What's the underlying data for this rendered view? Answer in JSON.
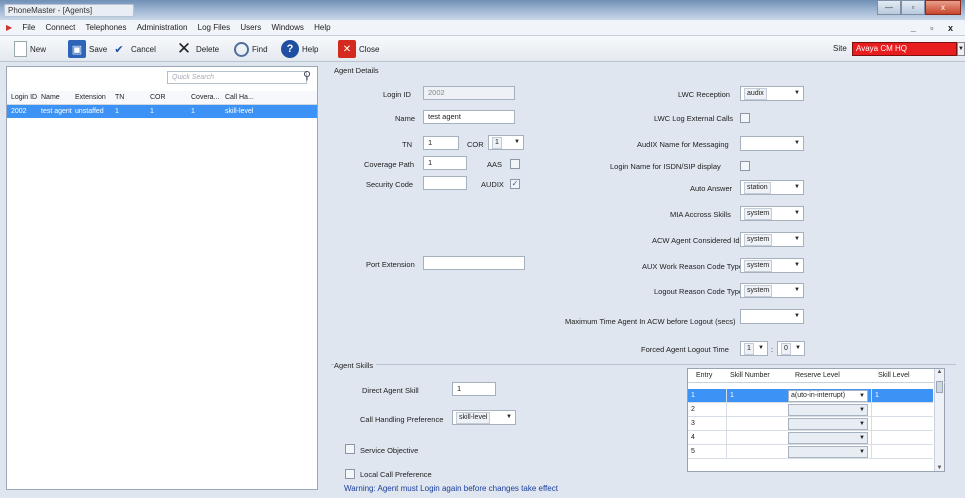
{
  "window": {
    "title": "PhoneMaster - [Agents]",
    "min_label": "—",
    "max_label": "▫",
    "close_label": "x"
  },
  "menu": {
    "items": [
      "File",
      "Connect",
      "Telephones",
      "Administration",
      "Log Files",
      "Users",
      "Windows",
      "Help"
    ],
    "mdi": "_ ▫ x"
  },
  "toolbar": {
    "new": "New",
    "save": "Save",
    "cancel": "Cancel",
    "delete": "Delete",
    "find": "Find",
    "help": "Help",
    "close": "Close"
  },
  "site": {
    "label": "Site",
    "value": "Avaya CM HQ"
  },
  "left": {
    "search_placeholder": "Quick Search",
    "columns": [
      "Login ID",
      "Name",
      "Extension",
      "TN",
      "COR",
      "Covera...",
      "Call Ha..."
    ],
    "rows": [
      [
        "2002",
        "test agent",
        "unstaffed",
        "1",
        "1",
        "1",
        "skill-level"
      ]
    ]
  },
  "details": {
    "section": "Agent Details",
    "login_id_label": "Login ID",
    "login_id": "2002",
    "name_label": "Name",
    "name": "test agent",
    "tn_label": "TN",
    "tn": "1",
    "cor_label": "COR",
    "cor": "1",
    "coverage_label": "Coverage Path",
    "coverage": "1",
    "aas_label": "AAS",
    "audix_label": "AUDIX",
    "security_label": "Security Code",
    "port_label": "Port Extension",
    "lwc_reception_label": "LWC Reception",
    "lwc_reception": "audix",
    "lwc_log_label": "LWC Log External Calls",
    "audix_name_label": "AudIX Name for Messaging",
    "login_name_label": "Login Name for ISDN/SIP display",
    "auto_answer_label": "Auto Answer",
    "auto_answer": "station",
    "mia_label": "MIA Accross Skills",
    "mia": "system",
    "acw_label": "ACW Agent Considered Idle",
    "acw": "system",
    "aux_label": "AUX Work Reason Code Type",
    "aux": "system",
    "logout_label": "Logout Reason Code Type",
    "logout": "system",
    "maxtime_label": "Maximum Time Agent In ACW before Logout (secs)",
    "forced_label": "Forced Agent Logout Time",
    "forced_h": "1",
    "forced_m": "0",
    "forced_sep": ":"
  },
  "skills": {
    "section": "Agent Skills",
    "direct_label": "Direct Agent Skill",
    "direct": "1",
    "chp_label": "Call Handling Preference",
    "chp": "skill-level",
    "service_label": "Service Objective",
    "local_label": "Local Call Preference",
    "columns": [
      "Entry",
      "Skill Number",
      "Reserve Level",
      "Skill Level"
    ],
    "rows": [
      [
        "1",
        "1",
        "a(uto-in-interrupt)",
        "1"
      ],
      [
        "2",
        "",
        "",
        ""
      ],
      [
        "3",
        "",
        "",
        ""
      ],
      [
        "4",
        "",
        "",
        ""
      ],
      [
        "5",
        "",
        "",
        ""
      ]
    ]
  },
  "warning": "Warning:  Agent must Login again before changes take effect"
}
